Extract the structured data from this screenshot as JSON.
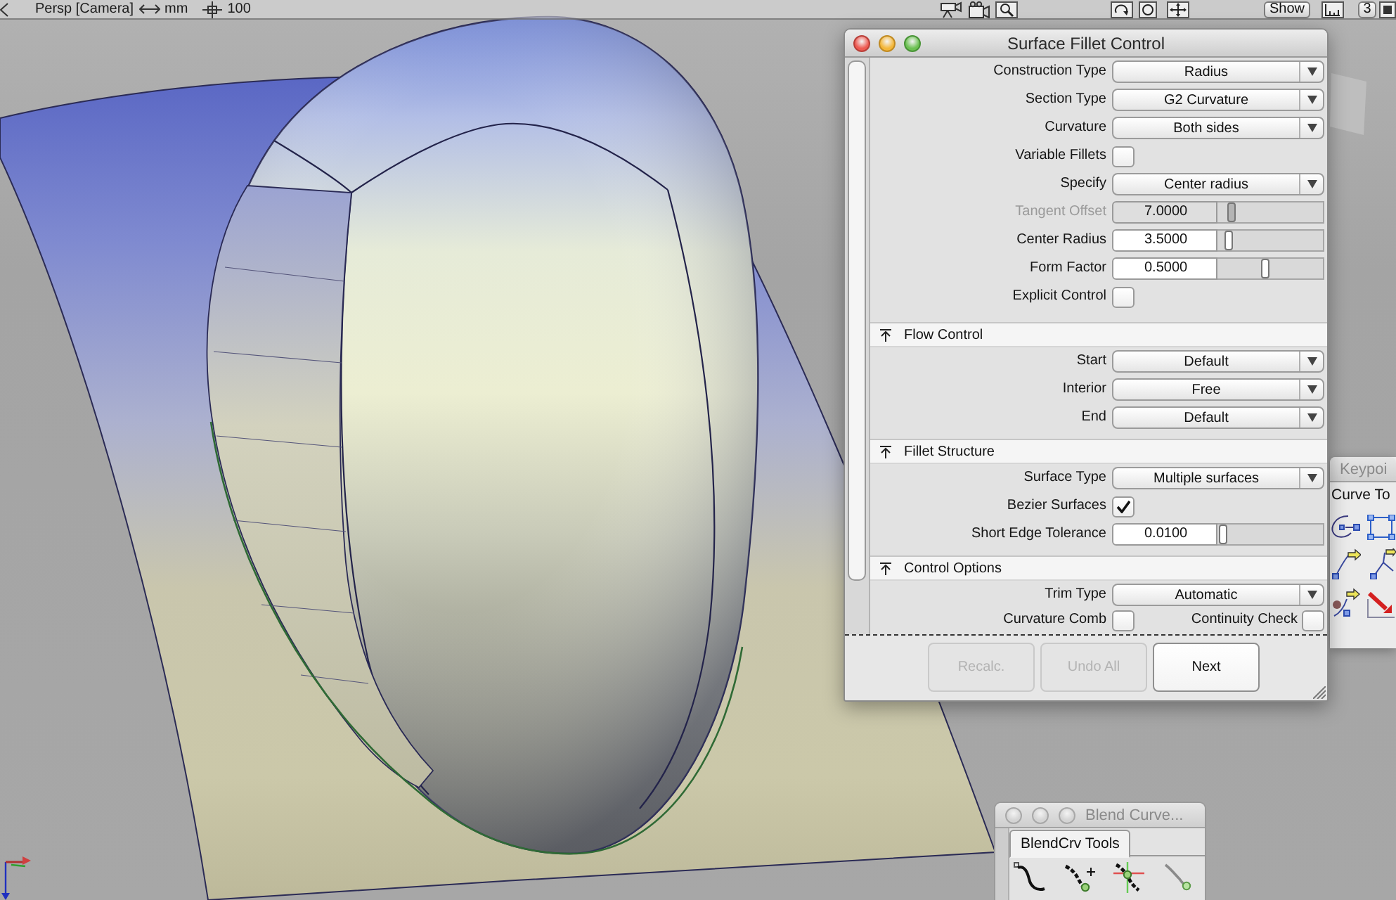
{
  "toolbar": {
    "view": "Persp [Camera]",
    "units": "mm",
    "scale": "100",
    "show_button": "Show",
    "layout_button": "3"
  },
  "fillet_dialog": {
    "title": "Surface Fillet Control",
    "sections": [
      {
        "rows": [
          {
            "kind": "dropdown",
            "label": "Construction Type",
            "value": "Radius"
          },
          {
            "kind": "dropdown",
            "label": "Section Type",
            "value": "G2 Curvature"
          },
          {
            "kind": "dropdown",
            "label": "Curvature",
            "value": "Both sides"
          },
          {
            "kind": "checkbox",
            "label": "Variable Fillets",
            "checked": false
          },
          {
            "kind": "dropdown",
            "label": "Specify",
            "value": "Center radius"
          },
          {
            "kind": "slider",
            "label": "Tangent Offset",
            "value": "7.0000",
            "level": 0.1,
            "disabled": true
          },
          {
            "kind": "slider",
            "label": "Center Radius",
            "value": "3.5000",
            "level": 0.07,
            "disabled": false
          },
          {
            "kind": "slider",
            "label": "Form Factor",
            "value": "0.5000",
            "level": 0.45,
            "disabled": false
          },
          {
            "kind": "checkbox",
            "label": "Explicit Control",
            "checked": false
          }
        ]
      },
      {
        "header": "Flow Control",
        "rows": [
          {
            "kind": "dropdown",
            "label": "Start",
            "value": "Default"
          },
          {
            "kind": "dropdown",
            "label": "Interior",
            "value": "Free"
          },
          {
            "kind": "dropdown",
            "label": "End",
            "value": "Default"
          }
        ]
      },
      {
        "header": "Fillet Structure",
        "rows": [
          {
            "kind": "dropdown",
            "label": "Surface Type",
            "value": "Multiple surfaces"
          },
          {
            "kind": "checkbox",
            "label": "Bezier Surfaces",
            "checked": true
          },
          {
            "kind": "slider",
            "label": "Short Edge Tolerance",
            "value": "0.0100",
            "level": 0.02,
            "disabled": false
          }
        ]
      },
      {
        "header": "Control Options",
        "rows": [
          {
            "kind": "dropdown",
            "label": "Trim Type",
            "value": "Automatic"
          },
          {
            "kind": "checkbox_pair",
            "items": [
              {
                "label": "Curvature Comb",
                "checked": false
              },
              {
                "label": "Continuity Check",
                "checked": false
              }
            ]
          }
        ]
      }
    ],
    "buttons": [
      {
        "label": "Recalc.",
        "disabled": true
      },
      {
        "label": "Undo All",
        "disabled": true
      },
      {
        "label": "Next",
        "disabled": false
      }
    ]
  },
  "keypoint_palette": {
    "title": "Keypoi",
    "tab": "Curve To"
  },
  "blend_palette": {
    "title": "Blend Curve...",
    "tab": "BlendCrv Tools"
  }
}
